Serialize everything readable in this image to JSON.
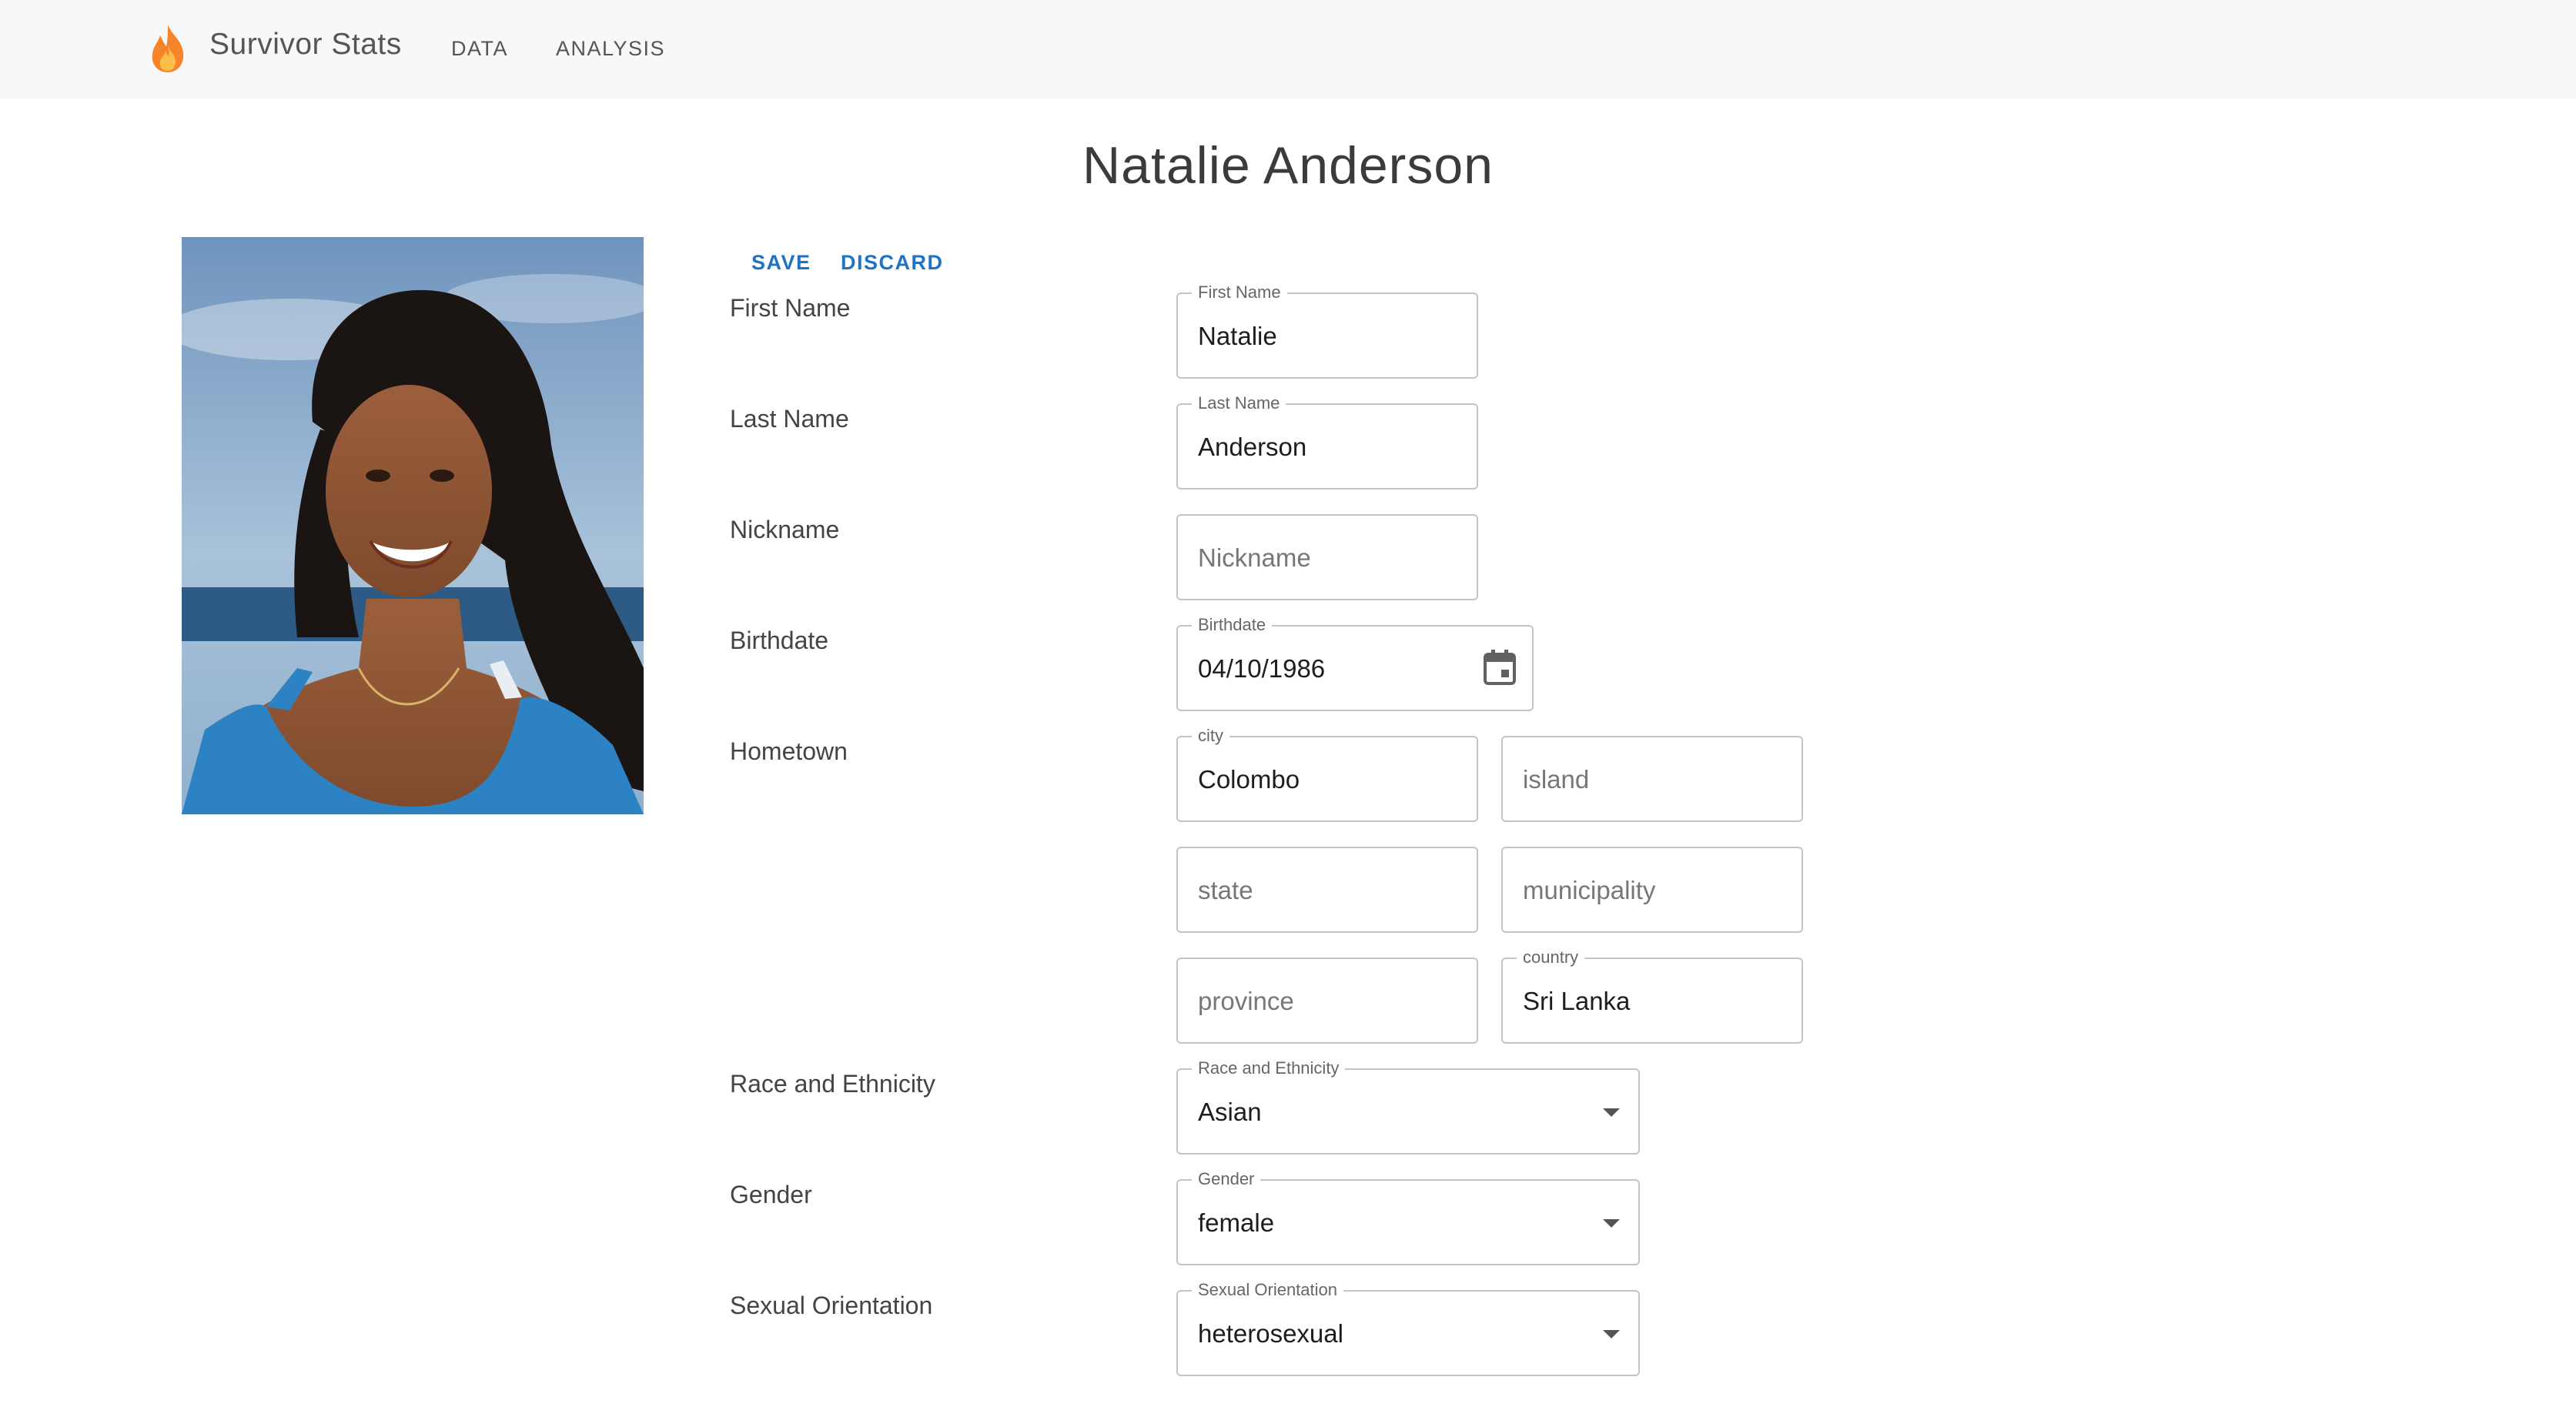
{
  "app": {
    "title": "Survivor Stats",
    "brand_icon": "flame-icon",
    "brand_color": "#f5842b"
  },
  "nav": [
    {
      "label": "DATA"
    },
    {
      "label": "ANALYSIS"
    }
  ],
  "page": {
    "title": "Natalie Anderson"
  },
  "actions": {
    "save": "SAVE",
    "discard": "DISCARD",
    "accent_color": "#1f72c4"
  },
  "labels": {
    "first_name": "First Name",
    "last_name": "Last Name",
    "nickname": "Nickname",
    "birthdate": "Birthdate",
    "hometown": "Hometown",
    "race": "Race and Ethnicity",
    "gender": "Gender",
    "orientation": "Sexual Orientation"
  },
  "fields": {
    "first_name": {
      "legend": "First Name",
      "value": "Natalie"
    },
    "last_name": {
      "legend": "Last Name",
      "value": "Anderson"
    },
    "nickname": {
      "placeholder": "Nickname"
    },
    "birthdate": {
      "legend": "Birthdate",
      "value": "04/10/1986",
      "icon": "calendar-icon"
    },
    "city": {
      "legend": "city",
      "value": "Colombo"
    },
    "island": {
      "placeholder": "island"
    },
    "state": {
      "placeholder": "state"
    },
    "municipality": {
      "placeholder": "municipality"
    },
    "province": {
      "placeholder": "province"
    },
    "country": {
      "legend": "country",
      "value": "Sri Lanka"
    },
    "race": {
      "legend": "Race and Ethnicity",
      "value": "Asian",
      "icon": "dropdown-arrow-icon"
    },
    "gender": {
      "legend": "Gender",
      "value": "female",
      "icon": "dropdown-arrow-icon"
    },
    "orientation": {
      "legend": "Sexual Orientation",
      "value": "heterosexual",
      "icon": "dropdown-arrow-icon"
    }
  }
}
